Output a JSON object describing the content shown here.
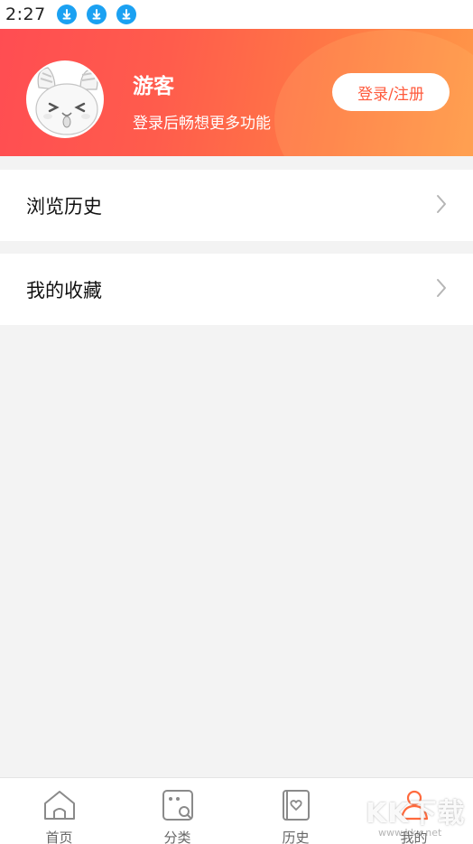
{
  "status_bar": {
    "time": "2:27",
    "icons": [
      "download-icon",
      "download-icon",
      "download-icon"
    ]
  },
  "colors": {
    "accent": "#ff5a3c",
    "status_icon": "#1ba1f2",
    "gradient_start": "#ff4d52",
    "gradient_end": "#ff9848"
  },
  "profile": {
    "name": "游客",
    "subtitle": "登录后畅想更多功能",
    "login_button": "登录/注册"
  },
  "menu": [
    {
      "label": "浏览历史",
      "icon": "chevron-right-icon"
    },
    {
      "label": "我的收藏",
      "icon": "chevron-right-icon"
    }
  ],
  "tabs": [
    {
      "label": "首页",
      "icon": "home-icon"
    },
    {
      "label": "分类",
      "icon": "category-icon"
    },
    {
      "label": "历史",
      "icon": "history-icon"
    },
    {
      "label": "我的",
      "icon": "user-icon",
      "active": true
    }
  ],
  "watermark": {
    "text": "KK下载",
    "sub": "www.kkx.net"
  }
}
